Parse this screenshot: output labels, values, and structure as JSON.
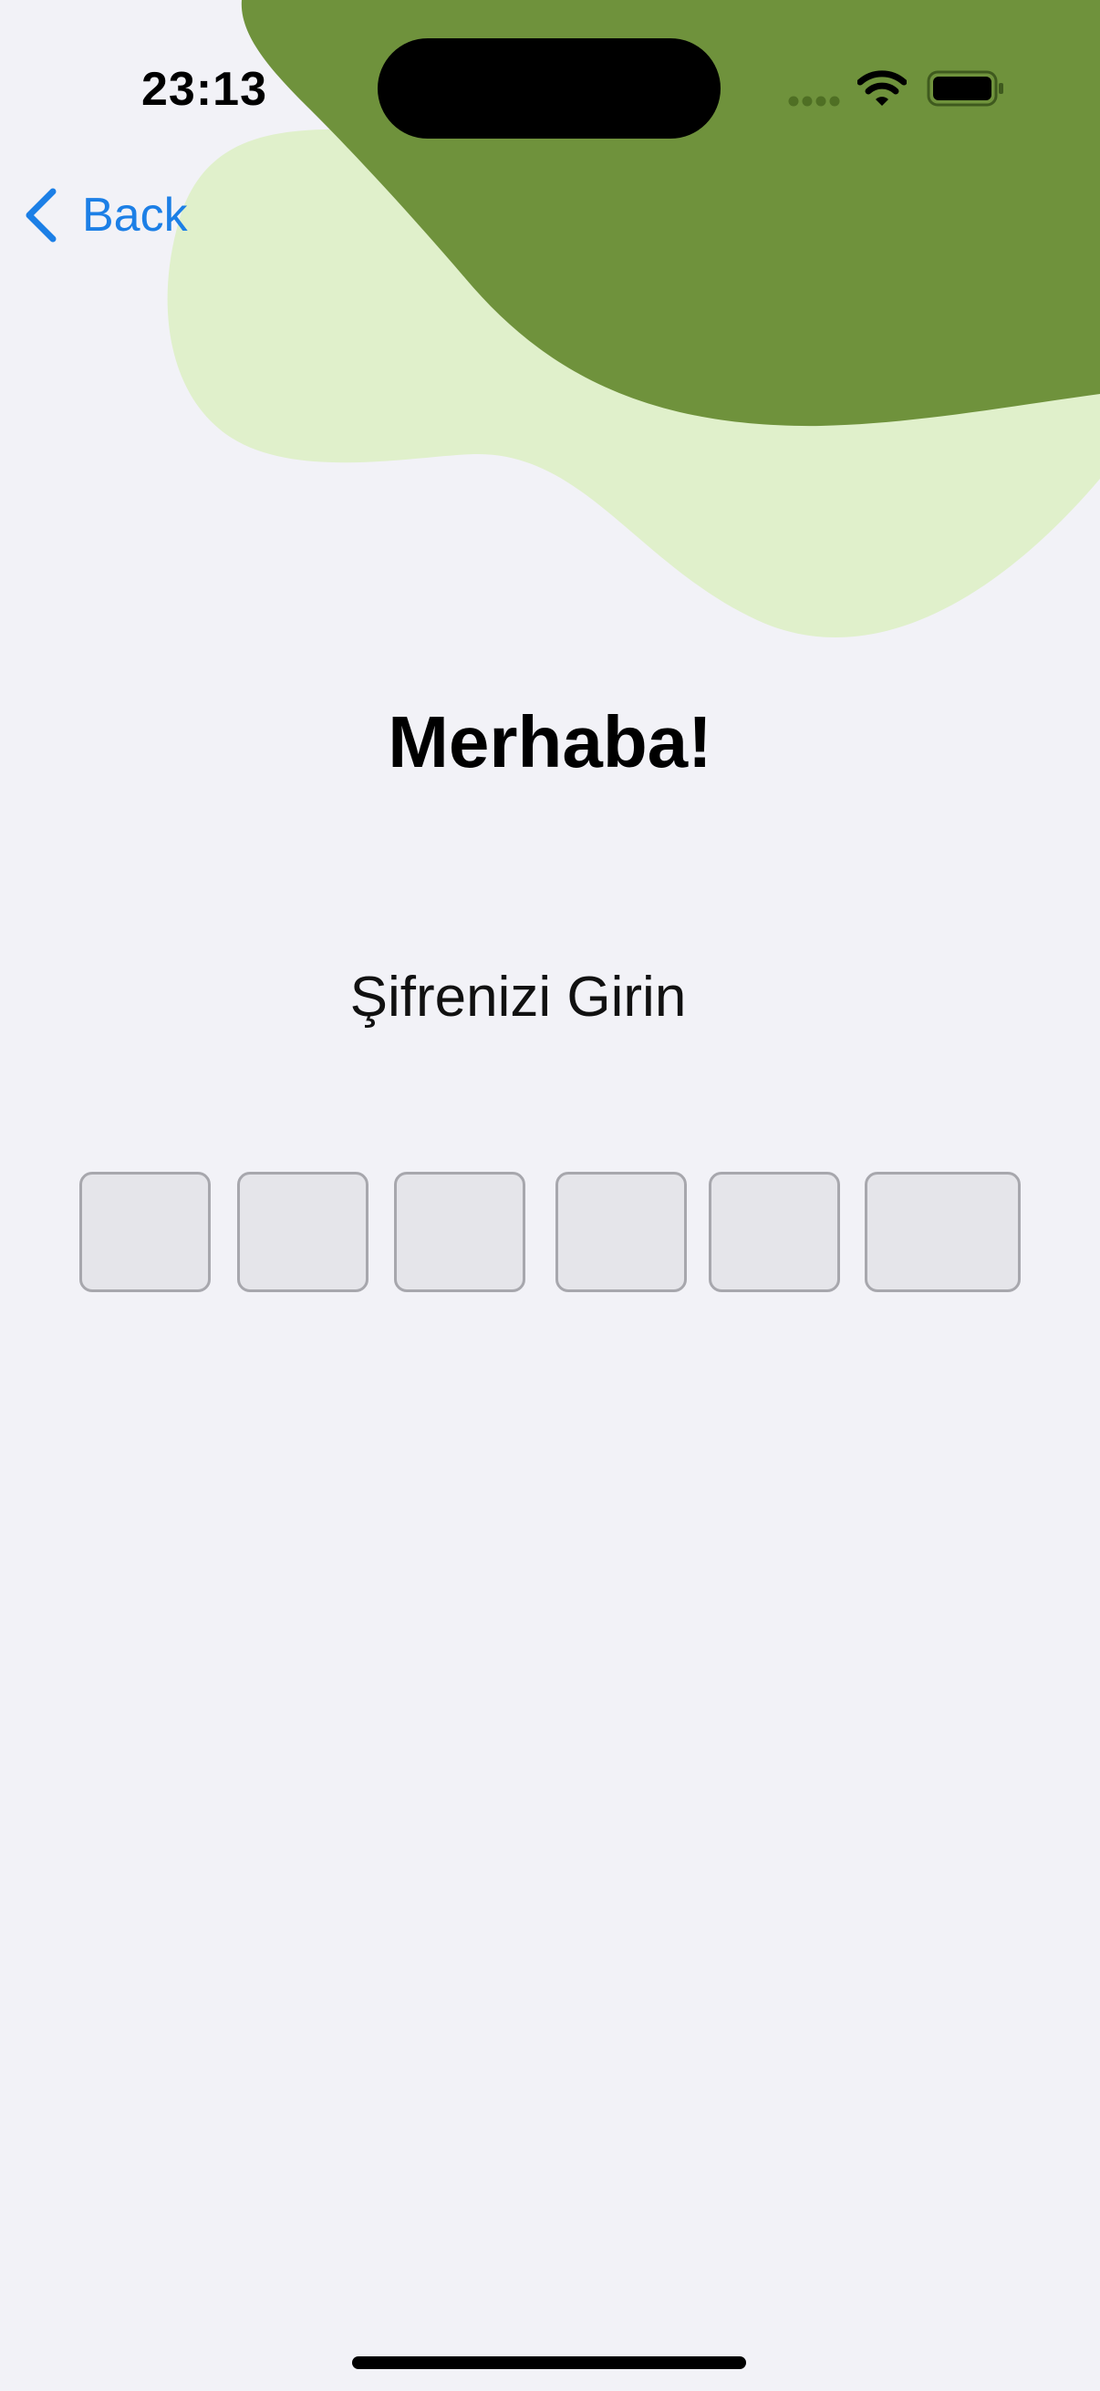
{
  "status_bar": {
    "time": "23:13"
  },
  "navigation": {
    "back_label": "Back"
  },
  "login": {
    "title": "Merhaba!",
    "prompt": "Şifrenizi Girin",
    "code_length": 6,
    "code_digits": [
      "",
      "",
      "",
      "",
      "",
      ""
    ]
  },
  "icons": {
    "back": "chevron-left-icon",
    "signal": "cellular-signal-icon",
    "wifi": "wifi-icon",
    "battery": "battery-icon"
  },
  "colors": {
    "accent": "#1c7fe6",
    "blob_dark_green": "#6f923c",
    "blob_light_green": "#e0f0cb",
    "background": "#f2f2f7",
    "code_box_fill": "#e5e5ea",
    "code_box_border": "#a7a7ad"
  }
}
